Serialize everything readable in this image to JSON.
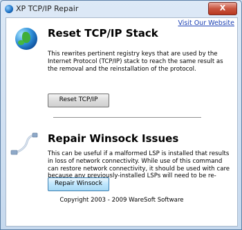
{
  "window": {
    "title": "XP TCP/IP Repair",
    "close_label": "X"
  },
  "header": {
    "visit_link": "Visit Our Website"
  },
  "tcpip": {
    "heading": "Reset TCP/IP Stack",
    "description": "This rewrites pertinent registry keys that are used by the Internet Protocol (TCP/IP) stack to reach the same result as the removal and the reinstallation of the protocol.",
    "button_label": "Reset TCP/IP",
    "icon": "globe-icon"
  },
  "winsock": {
    "heading": "Repair Winsock Issues",
    "description": "This can be useful if a malformed LSP is installed that results in loss of network connectivity. While use of this command can restore network connectivity, it should be used with care because any previously-installed LSPs will need to be re-installed.",
    "button_label": "Repair Winsock",
    "icon": "network-cable-icon"
  },
  "footer": {
    "copyright": "Copyright 2003 - 2009 WareSoft Software"
  }
}
